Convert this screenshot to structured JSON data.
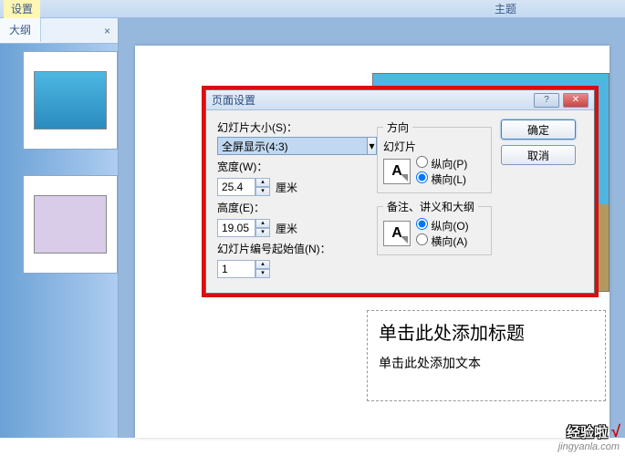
{
  "ribbon": {
    "tab_setup": "设置",
    "tab_theme": "主题"
  },
  "outline": {
    "tab_label": "大纲",
    "close_glyph": "×"
  },
  "slide": {
    "title_placeholder": "单击此处添加标题",
    "body_placeholder": "单击此处添加文本"
  },
  "dialog": {
    "title": "页面设置",
    "help_glyph": "?",
    "close_glyph": "✕",
    "left": {
      "size_label": "幻灯片大小(S)：",
      "size_value": "全屏显示(4:3)",
      "width_label": "宽度(W)：",
      "width_value": "25.4",
      "height_label": "高度(E)：",
      "height_value": "19.05",
      "unit": "厘米",
      "start_label": "幻灯片编号起始值(N)：",
      "start_value": "1"
    },
    "mid": {
      "group1_legend": "方向",
      "group1_sub": "幻灯片",
      "portrait": "纵向(P)",
      "landscape": "横向(L)",
      "group2_legend": "备注、讲义和大纲",
      "portrait2": "纵向(O)",
      "landscape2": "横向(A)",
      "icon_text": "A"
    },
    "buttons": {
      "ok": "确定",
      "cancel": "取消"
    }
  },
  "watermark": {
    "logo": "经验啦",
    "check": "√",
    "url": "jingyanla.com"
  }
}
